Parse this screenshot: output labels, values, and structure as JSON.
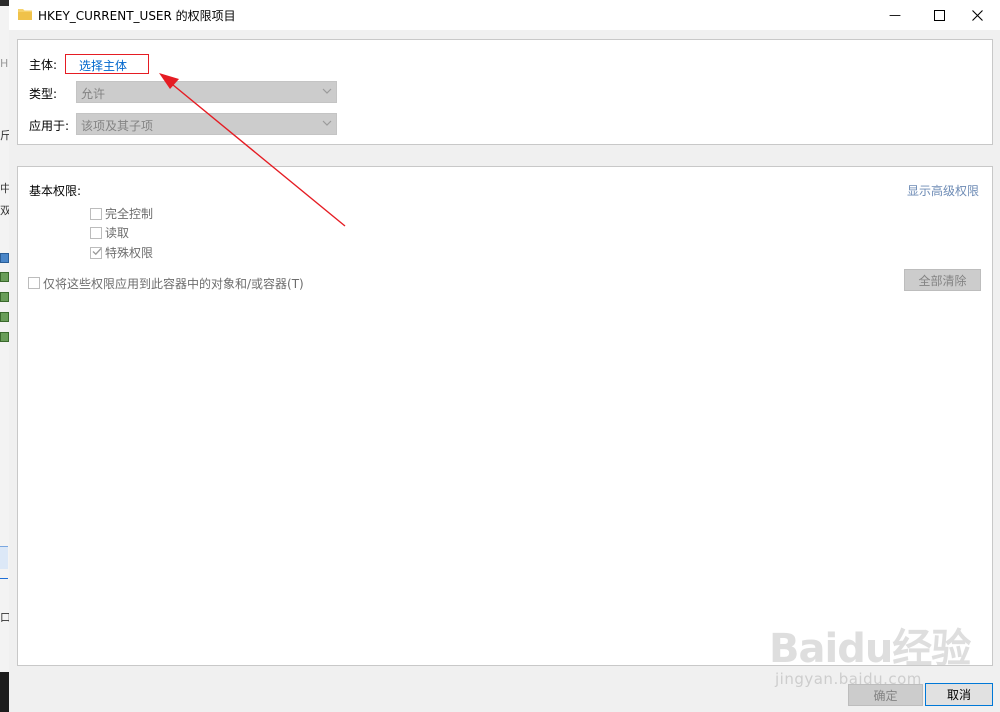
{
  "window": {
    "title": "HKEY_CURRENT_USER 的权限项目",
    "minimize_glyph": "—",
    "maximize_glyph": "☐",
    "close_glyph": "✕"
  },
  "background_fragments": [
    "H",
    "斤",
    "中",
    "双",
    "口"
  ],
  "principal": {
    "label": "主体:",
    "link": "选择主体"
  },
  "type": {
    "label": "类型:",
    "value": "允许"
  },
  "applies_to": {
    "label": "应用于:",
    "value": "该项及其子项"
  },
  "permissions": {
    "heading": "基本权限:",
    "show_advanced": "显示高级权限",
    "items": [
      {
        "label": "完全控制",
        "checked": false
      },
      {
        "label": "读取",
        "checked": false
      },
      {
        "label": "特殊权限",
        "checked": true
      }
    ],
    "apply_only_label": "仅将这些权限应用到此容器中的对象和/或容器(T)",
    "clear_all": "全部清除"
  },
  "footer": {
    "ok": "确定",
    "cancel": "取消"
  },
  "watermark": {
    "logo": "Baidu经验",
    "url": "jingyan.baidu.com"
  },
  "colors": {
    "annotation_red": "#e51c23",
    "link_blue": "#0066cc",
    "accent_blue": "#0078d7"
  }
}
